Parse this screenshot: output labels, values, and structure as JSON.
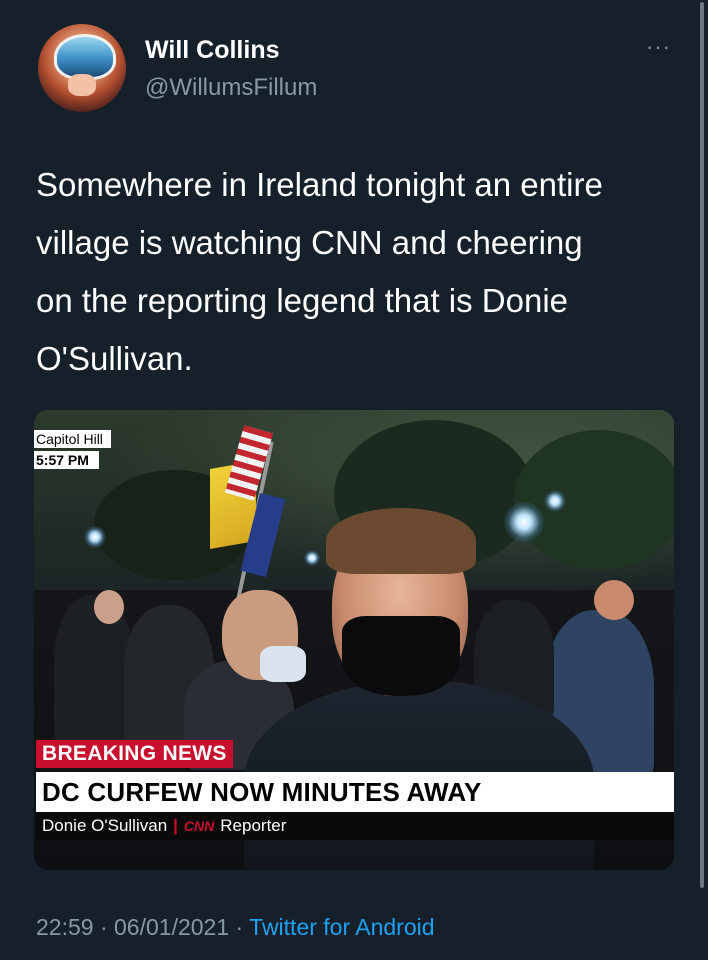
{
  "author": {
    "name": "Will Collins",
    "handle": "@WillumsFillum",
    "avatar_icon": "astronaut-helmet-avatar"
  },
  "more_menu": {
    "label": "···",
    "icon": "more-horizontal-icon"
  },
  "tweet": {
    "lines": [
      "Somewhere in Ireland tonight an entire",
      "village is watching CNN and cheering",
      "on the reporting legend that is Donie",
      "O'Sullivan."
    ]
  },
  "media": {
    "location_tag": "Capitol Hill",
    "time_tag": "5:57 PM",
    "breaking_label": "BREAKING NEWS",
    "headline": "DC CURFEW NOW MINUTES AWAY",
    "reporter_name": "Donie O'Sullivan",
    "separator": "|",
    "network_logo": "CNN",
    "reporter_role": "Reporter"
  },
  "meta": {
    "time": "22:59",
    "dot1": " · ",
    "date": "06/01/2021",
    "dot2": " · ",
    "source": "Twitter for Android"
  },
  "colors": {
    "background": "#15202b",
    "secondary_text": "#8899a6",
    "link": "#1da1f2",
    "breaking_red": "#c8102e"
  }
}
